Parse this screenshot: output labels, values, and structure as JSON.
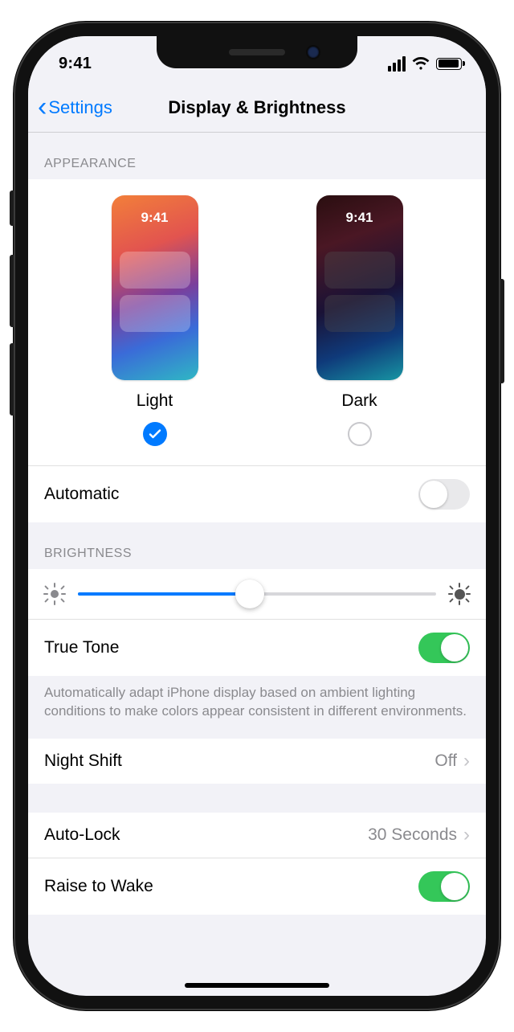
{
  "statusbar": {
    "time": "9:41"
  },
  "nav": {
    "back_label": "Settings",
    "title": "Display & Brightness"
  },
  "appearance": {
    "header": "APPEARANCE",
    "thumb_clock": "9:41",
    "light_label": "Light",
    "dark_label": "Dark",
    "selected": "light",
    "automatic_label": "Automatic",
    "automatic_on": false
  },
  "brightness": {
    "header": "BRIGHTNESS",
    "value_percent": 48,
    "truetone_label": "True Tone",
    "truetone_on": true,
    "truetone_footer": "Automatically adapt iPhone display based on ambient lighting conditions to make colors appear consistent in different environments."
  },
  "night_shift": {
    "label": "Night Shift",
    "value": "Off"
  },
  "auto_lock": {
    "label": "Auto-Lock",
    "value": "30 Seconds"
  },
  "raise_to_wake": {
    "label": "Raise to Wake",
    "on": true
  }
}
